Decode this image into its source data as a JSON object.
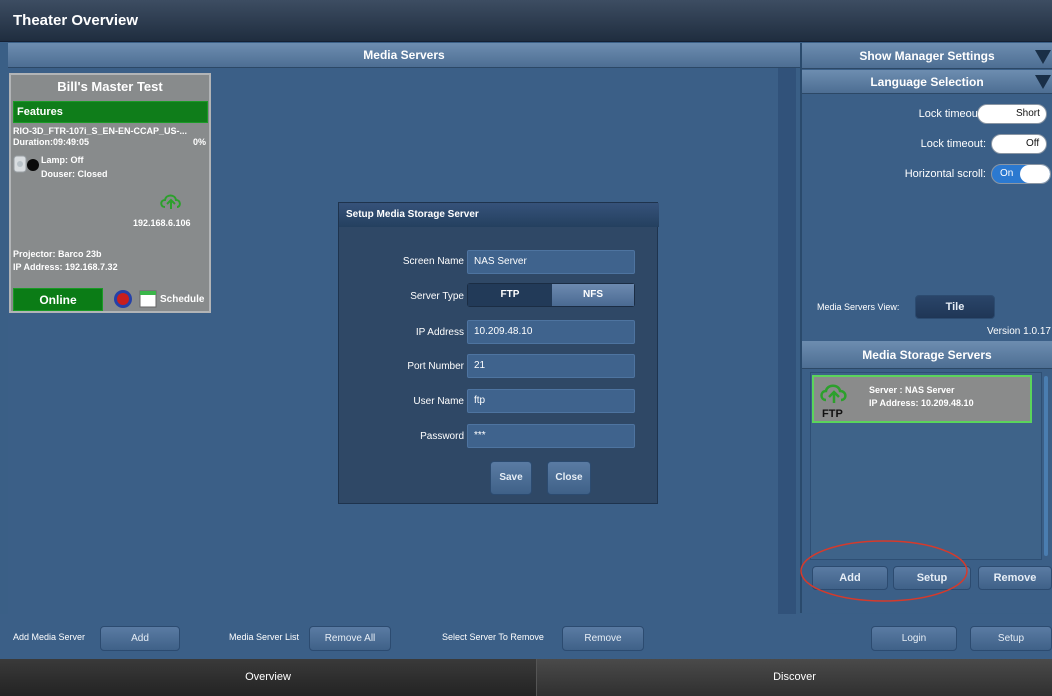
{
  "window": {
    "title": "Theater Overview"
  },
  "media_servers": {
    "header": "Media Servers",
    "card": {
      "title": "Bill's Master Test",
      "features_label": "Features",
      "playlist": "RIO-3D_FTR-107i_S_EN-EN-CCAP_US-...",
      "duration": "Duration:09:49:05",
      "progress": "0%",
      "lamp": "Lamp: Off",
      "douser": "Douser: Closed",
      "server_ip": "192.168.6.106",
      "projector": "Projector: Barco 23b",
      "ip_address": "IP Address: 192.168.7.32",
      "status": "Online",
      "schedule": "Schedule"
    }
  },
  "dialog": {
    "title": "Setup Media Storage Server",
    "fields": [
      {
        "label": "Screen Name",
        "value": "NAS Server"
      },
      {
        "label": "Server Type",
        "value": ""
      },
      {
        "label": "IP Address",
        "value": "10.209.48.10"
      },
      {
        "label": "Port Number",
        "value": "21"
      },
      {
        "label": "User Name",
        "value": "ftp"
      },
      {
        "label": "Password",
        "value": "***"
      }
    ],
    "server_type_options": [
      "FTP",
      "NFS"
    ],
    "selected_server_type": "NFS",
    "save_label": "Save",
    "close_label": "Close"
  },
  "right_panel": {
    "show_manager_settings": "Show Manager Settings",
    "language_selection": "Language Selection",
    "settings": [
      {
        "label": "Lock timeout:",
        "value": "Short"
      },
      {
        "label": "Lock timeout:",
        "value": "Off"
      },
      {
        "label": "Horizontal scroll:",
        "value": "On"
      }
    ],
    "media_servers_view_label": "Media Servers View:",
    "media_servers_view_value": "Tile",
    "version": "Version  1.0.17",
    "storage_header": "Media Storage Servers",
    "storage_item": {
      "name": "Server : NAS Server",
      "ip": "IP Address: 10.209.48.10",
      "type": "FTP"
    },
    "add_label": "Add",
    "setup_label": "Setup",
    "remove_label": "Remove"
  },
  "bottom_bar": {
    "add_media_server_label": "Add Media Server",
    "add_button": "Add",
    "media_server_list_label": "Media Server List",
    "remove_all_button": "Remove All",
    "select_server_label": "Select Server To Remove",
    "remove_button": "Remove",
    "login_button": "Login",
    "setup_button": "Setup"
  },
  "tabs": [
    {
      "label": "Overview"
    },
    {
      "label": "Discover"
    }
  ],
  "colors": {
    "online": "#0b7c16",
    "features": "#0f7d1a",
    "selected_highlight": "#5bd45b",
    "annotation": "#d63a2b"
  }
}
